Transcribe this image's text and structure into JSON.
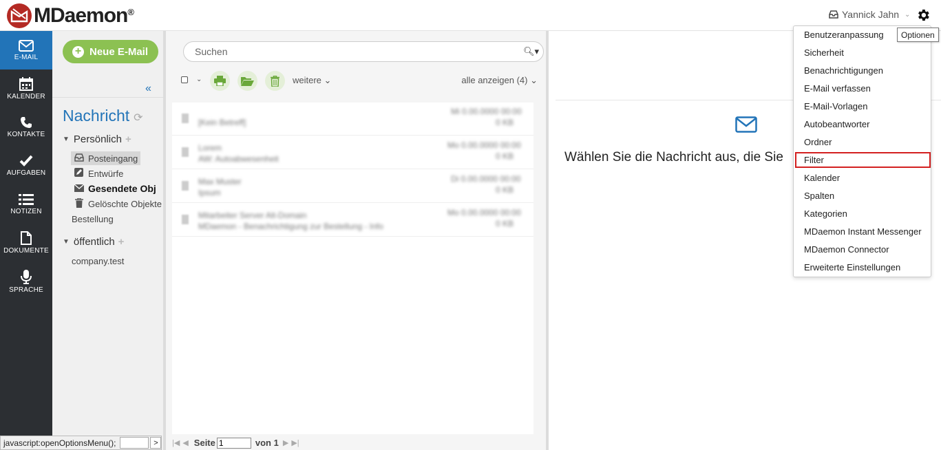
{
  "app": {
    "brand": "MDaemon",
    "reg": "®"
  },
  "header": {
    "user_name": "Yannick Jahn"
  },
  "nav": [
    {
      "label": "E-MAIL",
      "icon": "envelope-icon"
    },
    {
      "label": "KALENDER",
      "icon": "calendar-icon"
    },
    {
      "label": "KONTAKTE",
      "icon": "phone-icon"
    },
    {
      "label": "AUFGABEN",
      "icon": "checkmark-icon"
    },
    {
      "label": "NOTIZEN",
      "icon": "list-icon"
    },
    {
      "label": "DOKUMENTE",
      "icon": "document-icon"
    },
    {
      "label": "SPRACHE",
      "icon": "microphone-icon"
    }
  ],
  "folders": {
    "new_mail": "Neue E-Mail",
    "title": "Nachricht",
    "personal": "Persönlich",
    "items": [
      "Posteingang",
      "Entwürfe",
      "Gesendete Obj",
      "Gelöschte Objekte"
    ],
    "plain": "Bestellung",
    "public": "öffentlich",
    "public_item": "company.test"
  },
  "list": {
    "search_placeholder": "Suchen",
    "more": "weitere",
    "show_all": "alle anzeigen (4)",
    "pager": {
      "page_label": "Seite",
      "page_value": "1",
      "of_label": "von 1"
    }
  },
  "reader": {
    "hint": "Wählen Sie die Nachricht aus, die Sie"
  },
  "options_menu": {
    "items": [
      "Benutzeranpassung",
      "Sicherheit",
      "Benachrichtigungen",
      "E-Mail verfassen",
      "E-Mail-Vorlagen",
      "Autobeantworter",
      "Ordner",
      "Filter",
      "Kalender",
      "Spalten",
      "Kategorien",
      "MDaemon Instant Messenger",
      "MDaemon Connector",
      "Erweiterte Einstellungen"
    ],
    "highlighted": "Filter"
  },
  "tooltip": "Optionen",
  "statusbar": {
    "text": "javascript:openOptionsMenu();"
  },
  "colors": {
    "accent": "#2274b8",
    "green": "#8cc152",
    "sidebar": "#2c2f33",
    "highlight": "#d31f1f"
  }
}
